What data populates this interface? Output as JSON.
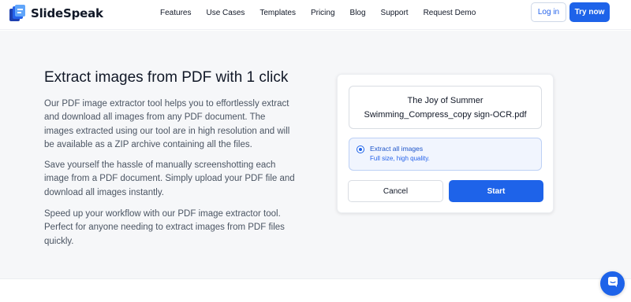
{
  "header": {
    "brand": "SlideSpeak",
    "brand_icon": "slidespeak-logo-icon",
    "nav": [
      {
        "label": "Features"
      },
      {
        "label": "Use Cases"
      },
      {
        "label": "Templates"
      },
      {
        "label": "Pricing"
      },
      {
        "label": "Blog"
      },
      {
        "label": "Support"
      },
      {
        "label": "Request Demo"
      }
    ],
    "login_label": "Log in",
    "try_label": "Try now"
  },
  "hero": {
    "title": "Extract images from PDF with 1 click",
    "paragraphs": [
      "Our PDF image extractor tool helps you to effortlessly extract and download all images from any PDF document. The images extracted using our tool are in high resolution and will be available as a ZIP archive containing all the files.",
      "Save yourself the hassle of manually screenshotting each image from a PDF document. Simply upload your PDF file and download all images instantly.",
      "Speed up your workflow with our PDF image extractor tool. Perfect for anyone needing to extract images from PDF files quickly."
    ]
  },
  "card": {
    "file_title": "The Joy of Summer",
    "file_name": "Swimming_Compress_copy sign-OCR.pdf",
    "option": {
      "title": "Extract all images",
      "subtitle": "Full size, high quality.",
      "selected": true
    },
    "cancel_label": "Cancel",
    "start_label": "Start"
  },
  "chat": {
    "icon": "chat-icon"
  },
  "colors": {
    "accent": "#1e63e9",
    "band_background": "#f6f7f9",
    "option_background": "#f1f5fe"
  }
}
